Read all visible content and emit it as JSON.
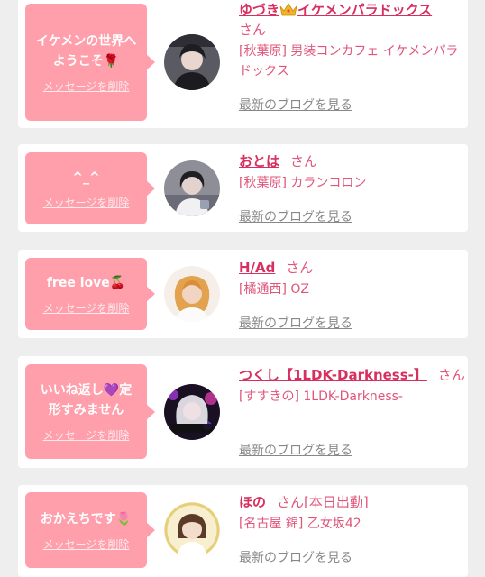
{
  "delete_label": "メッセージを削除",
  "blog_label": "最新のブログを見る",
  "honorific": "さん",
  "colors": {
    "bubble": "#ff9fac",
    "name": "#d72f60",
    "text": "#e0557a",
    "link_gray": "#888888",
    "background": "#eeeeee"
  },
  "cards": [
    {
      "message": "イケメンの世界へようこそ🌹",
      "name_before_icon": "ゆづき",
      "name_icon": "crown-icon",
      "name_after_icon": "イケメンパラドックス",
      "place": "[秋葉原] 男装コンカフェ イケメンパラドックス"
    },
    {
      "message": "^_^",
      "name": "おとは",
      "place": "[秋葉原] カランコロン"
    },
    {
      "message": "free love🍒",
      "name": "H/Ad",
      "place": "[橘通西] OZ"
    },
    {
      "message": "いいね返し💜定形すみません",
      "name": "つくし【1LDK-Darkness-】",
      "place": "[すすきの] 1LDK-Darkness-"
    },
    {
      "message": "おかえちです🌷",
      "name": "ほの",
      "status": "[本日出勤]",
      "place": "[名古屋 錦] 乙女坂42"
    }
  ]
}
